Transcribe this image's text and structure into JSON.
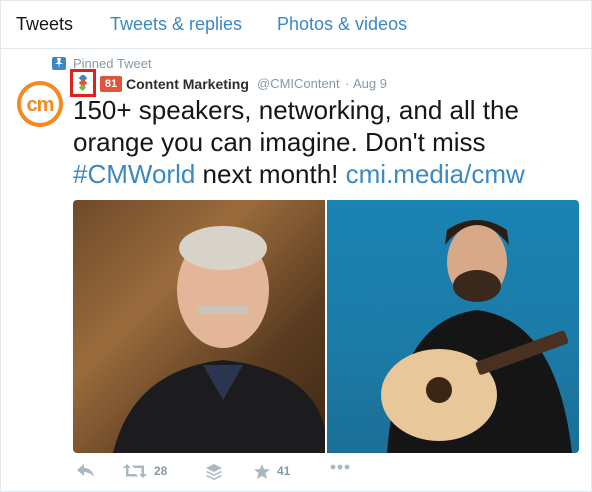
{
  "tabs": [
    {
      "label": "Tweets",
      "active": true
    },
    {
      "label": "Tweets & replies",
      "active": false
    },
    {
      "label": "Photos & videos",
      "active": false
    }
  ],
  "pinned": {
    "label": "Pinned Tweet",
    "icon": "pin-icon"
  },
  "tweet": {
    "avatar_text": "cm",
    "extension_badge": "81",
    "author_name": "Content Marketing",
    "handle": "@CMIContent",
    "separator": "·",
    "date": "Aug 9",
    "text_part1": "150+ speakers, networking, and all the orange you can imagine. Don't miss ",
    "hashtag": "#CMWorld",
    "text_part2": " next month! ",
    "link": "cmi.media/cmw"
  },
  "actions": {
    "retweet_count": "28",
    "favorite_count": "41"
  },
  "colors": {
    "accent": "#3b88c3",
    "brand_orange": "#f18a21",
    "badge": "#e0543a",
    "highlight_border": "#e0201b",
    "muted": "#8899a6"
  }
}
